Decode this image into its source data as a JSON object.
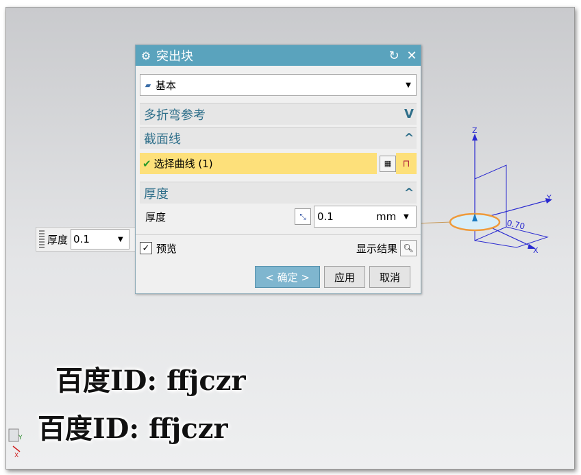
{
  "dialog": {
    "title": "突出块",
    "type_combo": {
      "value": "基本"
    },
    "sections": {
      "multibend": {
        "label": "多折弯参考"
      },
      "section_line": {
        "label": "截面线",
        "select_label": "选择曲线 (1)"
      },
      "thickness": {
        "label": "厚度",
        "field_label": "厚度",
        "value": "0.1",
        "unit": "mm"
      }
    },
    "preview": {
      "label": "预览",
      "show_result": "显示结果"
    },
    "buttons": {
      "ok": "< 确定 >",
      "apply": "应用",
      "cancel": "取消"
    }
  },
  "floating_toolbar": {
    "label": "厚度",
    "value": "0.1"
  },
  "axes": {
    "x": "X",
    "y": "Y",
    "z": "Z"
  },
  "watermark": {
    "line1": "百度ID: ffjczr",
    "line2": "百度ID: ffjczr"
  }
}
